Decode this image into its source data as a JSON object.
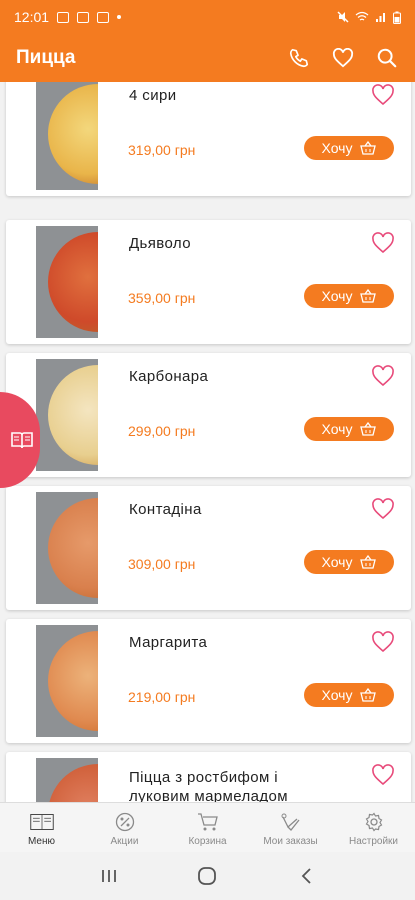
{
  "status_bar": {
    "time": "12:01"
  },
  "app_bar": {
    "title": "Пицца",
    "icons": [
      "phone-icon",
      "heart-icon",
      "search-icon"
    ]
  },
  "colors": {
    "accent": "#f47b20",
    "side_tab": "#e84a5f"
  },
  "products": [
    {
      "name": "4 сири",
      "price": "319,00 грн",
      "button": "Хочу"
    },
    {
      "name": "Дьяволо",
      "price": "359,00 грн",
      "button": "Хочу"
    },
    {
      "name": "Карбонара",
      "price": "299,00 грн",
      "button": "Хочу"
    },
    {
      "name": "Контадіна",
      "price": "309,00 грн",
      "button": "Хочу"
    },
    {
      "name": "Маргарита",
      "price": "219,00 грн",
      "button": "Хочу"
    },
    {
      "name": "Піцца з ростбифом і луковим мармеладом",
      "price": "",
      "button": ""
    }
  ],
  "tabs": [
    {
      "label": "Меню",
      "icon": "menu-book-icon",
      "active": true
    },
    {
      "label": "Акции",
      "icon": "percent-icon",
      "active": false
    },
    {
      "label": "Корзина",
      "icon": "cart-icon",
      "active": false
    },
    {
      "label": "Мои заказы",
      "icon": "orders-icon",
      "active": false
    },
    {
      "label": "Настройки",
      "icon": "gear-icon",
      "active": false
    }
  ],
  "system_nav": [
    "recent-apps-icon",
    "home-icon",
    "back-icon"
  ]
}
